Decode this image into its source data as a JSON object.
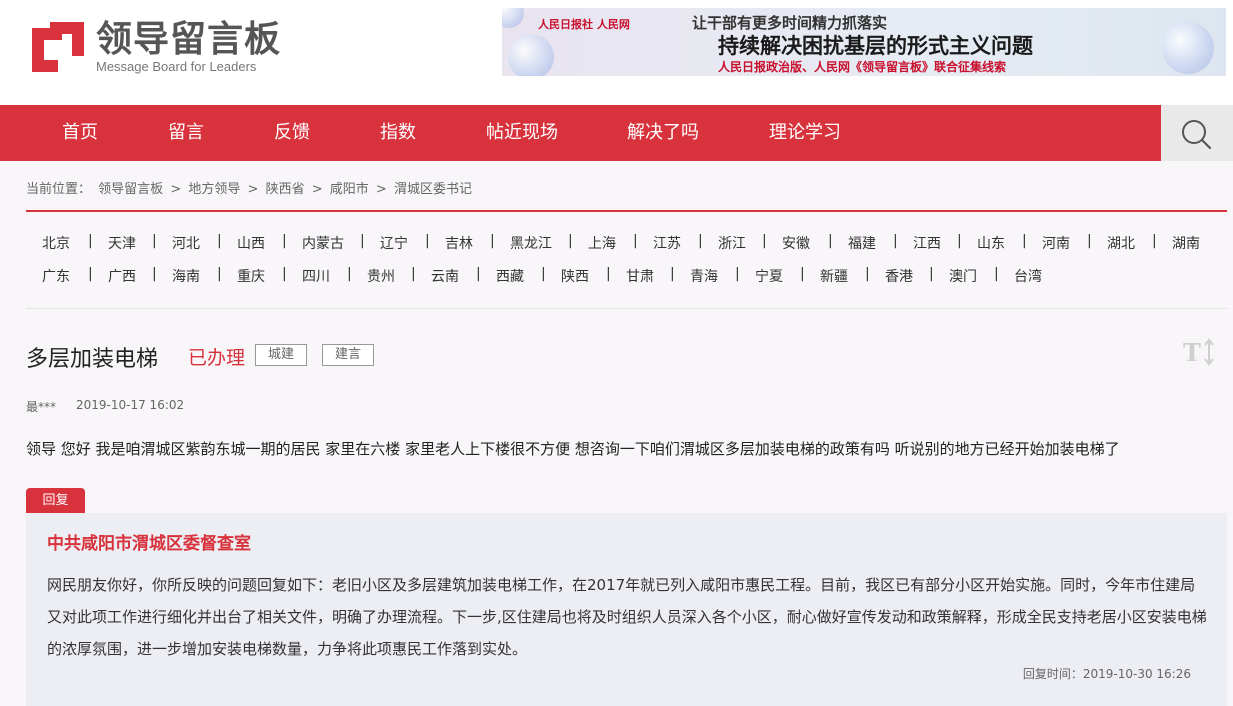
{
  "logo": {
    "name_cn": "领导留言板",
    "name_en": "Message Board for Leaders",
    "brand_color": "#d8323c"
  },
  "banner": {
    "partner_logos": "人民日报社  人民网",
    "line1": "让干部有更多时间精力抓落实",
    "line2": "持续解决困扰基层的形式主义问题",
    "line3": "人民日报政治版、人民网《领导留言板》联合征集线索"
  },
  "nav": {
    "items": [
      "首页",
      "留言",
      "反馈",
      "指数",
      "帖近现场",
      "解决了吗",
      "理论学习"
    ],
    "search_icon": "search-icon",
    "background": "#d8323c"
  },
  "breadcrumb": {
    "prefix": "当前位置：",
    "items": [
      "领导留言板",
      "地方领导",
      "陕西省",
      "咸阳市",
      "渭城区委书记"
    ],
    "separator": ">"
  },
  "provinces": {
    "row1": [
      "北京",
      "天津",
      "河北",
      "山西",
      "内蒙古",
      "辽宁",
      "吉林",
      "黑龙江",
      "上海",
      "江苏",
      "浙江",
      "安徽",
      "福建",
      "江西",
      "山东",
      "河南",
      "湖北",
      "湖南"
    ],
    "row2": [
      "广东",
      "广西",
      "海南",
      "重庆",
      "四川",
      "贵州",
      "云南",
      "西藏",
      "陕西",
      "甘肃",
      "青海",
      "宁夏",
      "新疆",
      "香港",
      "澳门",
      "台湾"
    ],
    "separator": "|"
  },
  "message": {
    "title": "多层加装电梯",
    "status": "已办理",
    "tags": [
      "城建",
      "建言"
    ],
    "author": "最***",
    "date": "2019-10-17 16:02",
    "body": "领导 您好  我是咱渭城区紫韵东城一期的居民  家里在六楼 家里老人上下楼很不方便 想咨询一下咱们渭城区多层加装电梯的政策有吗  听说别的地方已经开始加装电梯了",
    "font_toggle_icon": "text-size-icon"
  },
  "reply": {
    "label": "回复",
    "org": "中共咸阳市渭城区委督查室",
    "text": "网民朋友你好，你所反映的问题回复如下：老旧小区及多层建筑加装电梯工作，在2017年就已列入咸阳市惠民工程。目前，我区已有部分小区开始实施。同时，今年市住建局又对此项工作进行细化并出台了相关文件，明确了办理流程。下一步,区住建局也将及时组织人员深入各个小区，耐心做好宣传发动和政策解释，形成全民支持老居小区安装电梯的浓厚氛围，进一步增加安装电梯数量，力争将此项惠民工作落到实处。",
    "time": "回复时间：2019-10-30 16:26"
  }
}
